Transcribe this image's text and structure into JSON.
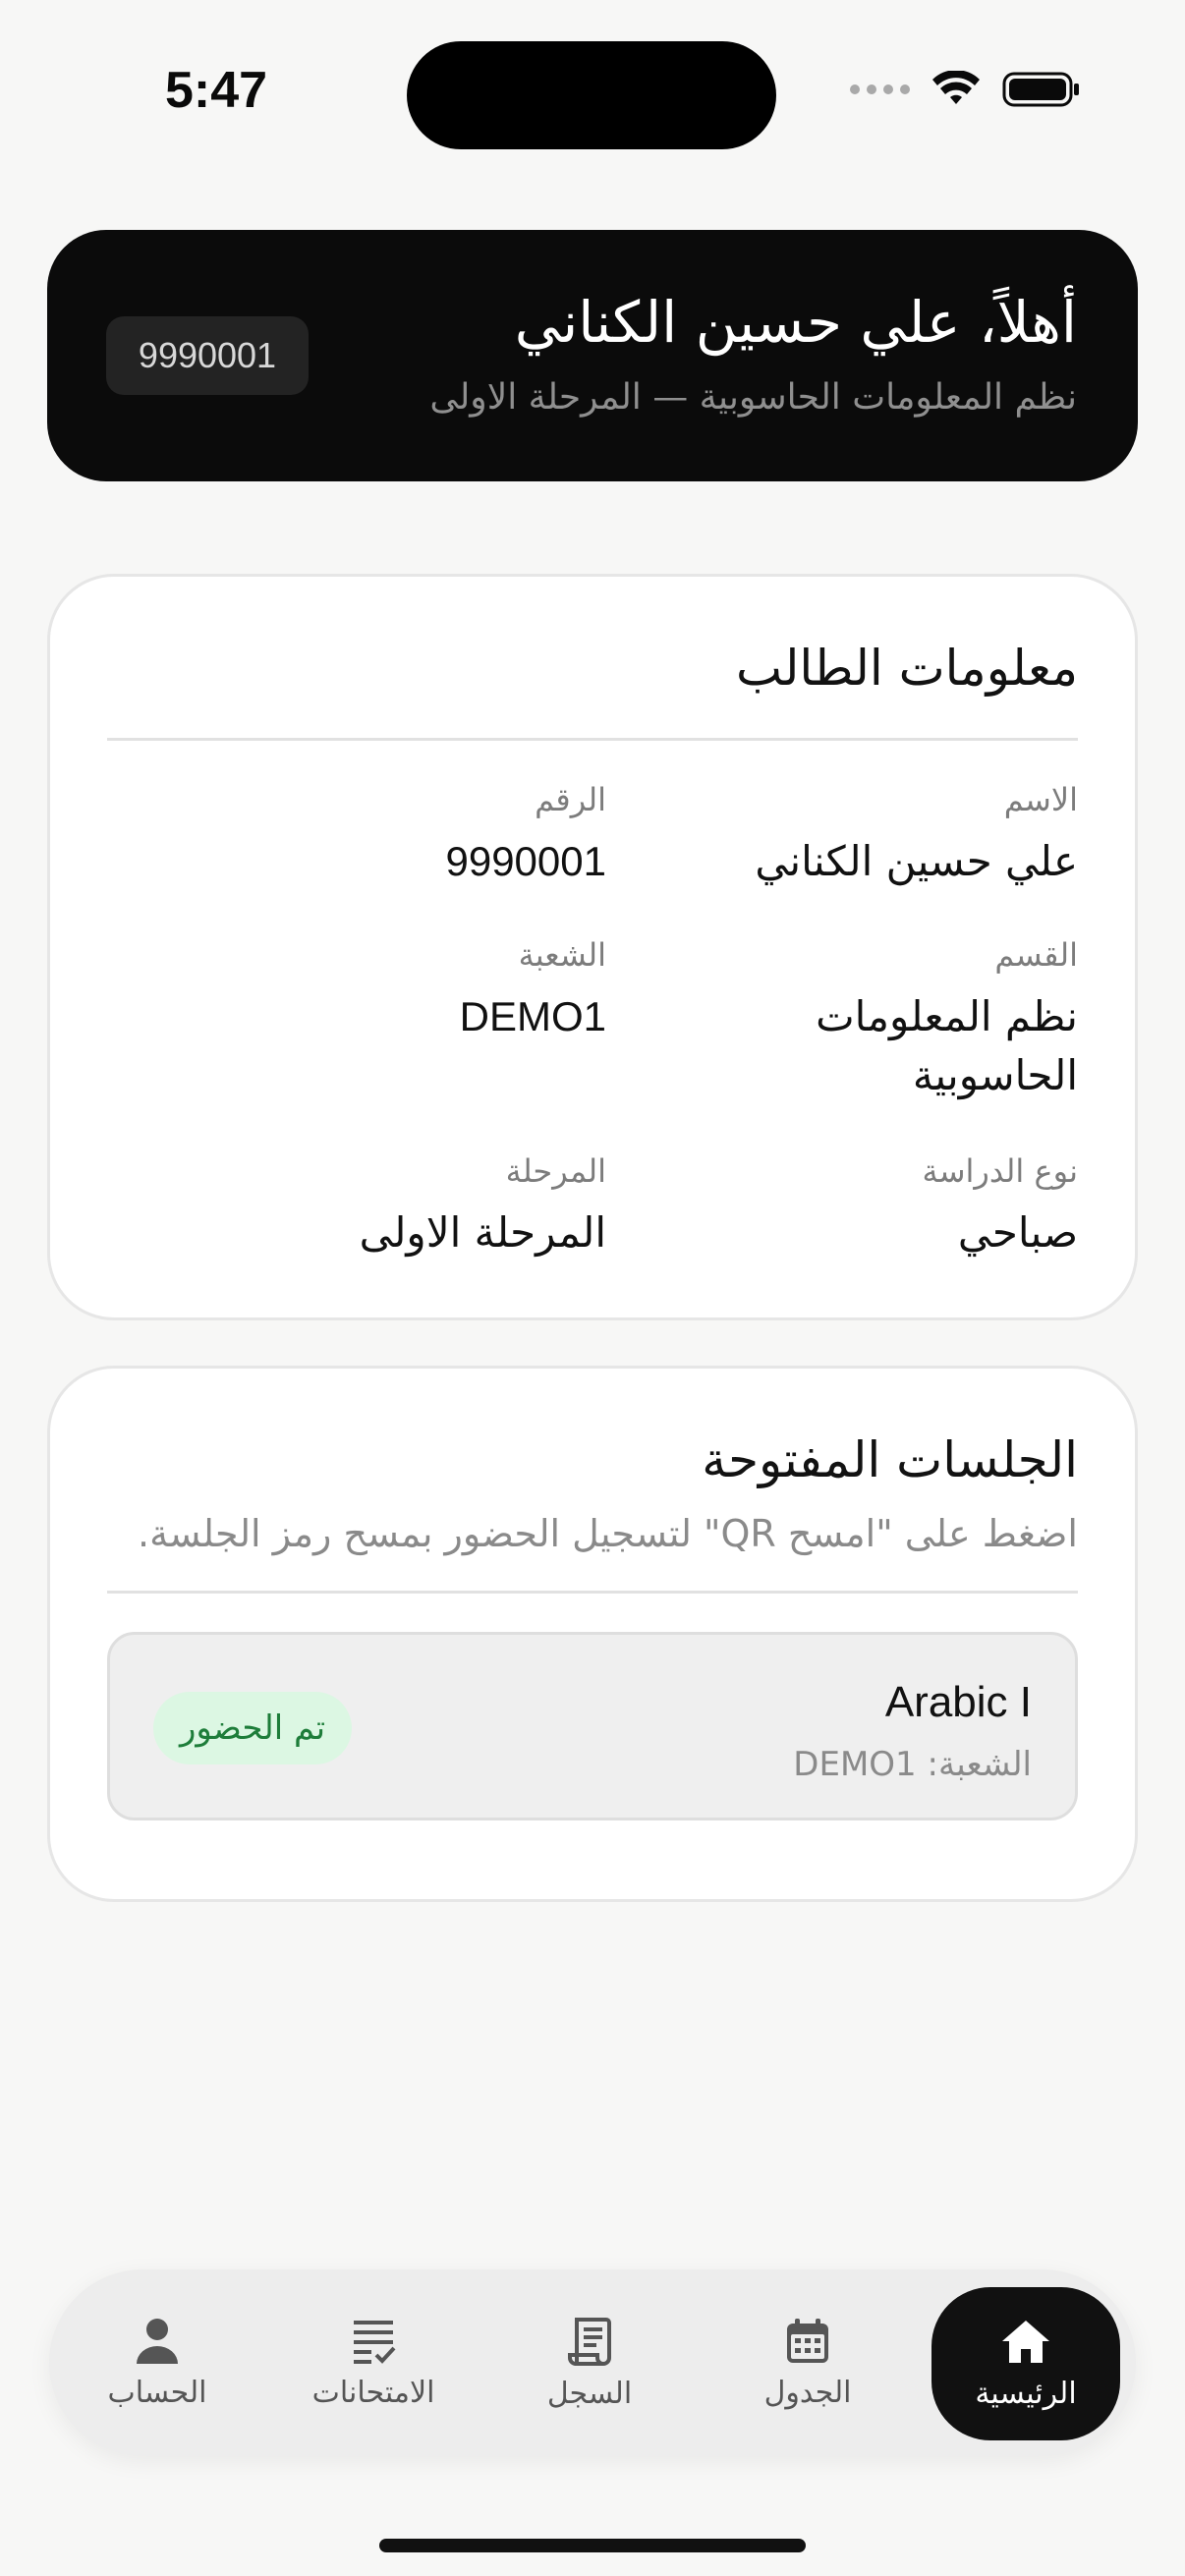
{
  "status_bar": {
    "time": "5:47"
  },
  "header": {
    "greeting": "أهلاً، علي حسين الكناني",
    "subtitle": "نظم المعلومات الحاسوبية — المرحلة الاولى",
    "student_id": "9990001"
  },
  "student_info": {
    "title": "معلومات الطالب",
    "fields": [
      {
        "label": "الاسم",
        "value": "علي حسين الكناني"
      },
      {
        "label": "الرقم",
        "value": "9990001"
      },
      {
        "label": "القسم",
        "value": "نظم المعلومات الحاسوبية"
      },
      {
        "label": "الشعبة",
        "value": "DEMO1"
      },
      {
        "label": "نوع الدراسة",
        "value": "صباحي"
      },
      {
        "label": "المرحلة",
        "value": "المرحلة الاولى"
      }
    ]
  },
  "sessions": {
    "title": "الجلسات المفتوحة",
    "subtitle": "اضغط على \"امسح QR\" لتسجيل الحضور بمسح رمز الجلسة.",
    "items": [
      {
        "name": "Arabic I",
        "branch": "الشعبة: DEMO1",
        "status": "تم الحضور"
      }
    ]
  },
  "tabbar": {
    "tabs": [
      {
        "label": "الرئيسية",
        "icon": "home-icon",
        "active": true
      },
      {
        "label": "الجدول",
        "icon": "calendar-icon"
      },
      {
        "label": "السجل",
        "icon": "receipt-icon"
      },
      {
        "label": "الامتحانات",
        "icon": "checklist-icon"
      },
      {
        "label": "الحساب",
        "icon": "person-icon"
      }
    ]
  },
  "colors": {
    "header_bg": "#0b0b0b",
    "attended_bg": "#dcf7e3",
    "attended_text": "#1e7d3a"
  }
}
